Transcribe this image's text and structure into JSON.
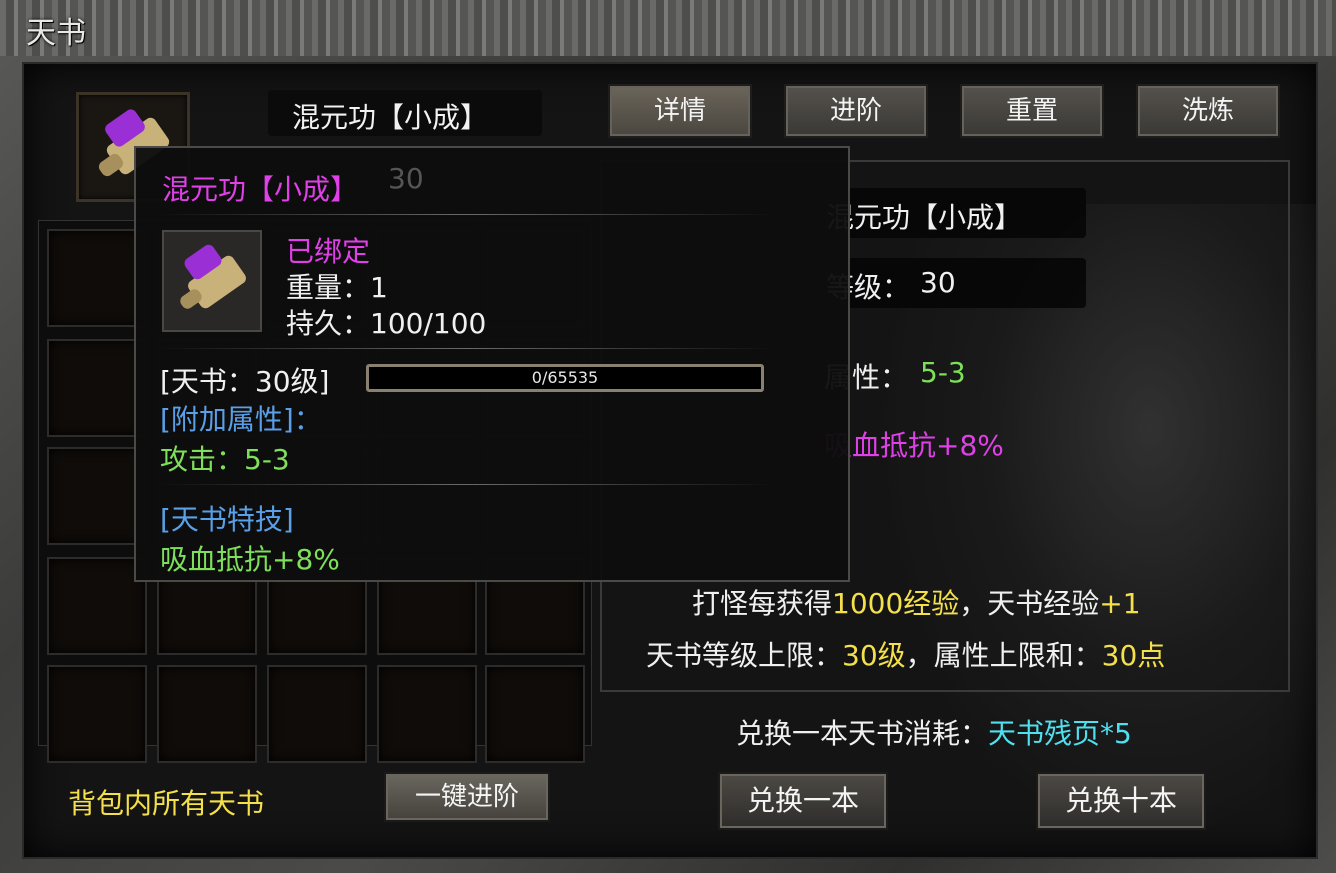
{
  "window": {
    "title": "天书"
  },
  "item": {
    "name": "混元功【小成】"
  },
  "tabs": [
    {
      "label": "详情",
      "active": true
    },
    {
      "label": "进阶",
      "active": false
    },
    {
      "label": "重置",
      "active": false
    },
    {
      "label": "洗炼",
      "active": false
    }
  ],
  "detail": {
    "name": "混元功【小成】",
    "level_label": "等级：",
    "level_value": "30",
    "attr_label": "属性：",
    "attr_value": "5-3",
    "special": "吸血抵抗+8%"
  },
  "info": {
    "exp_prefix": "打怪每获得",
    "exp_amount": "1000经验",
    "exp_middle": "，天书经验",
    "exp_gain": "+1",
    "limit_prefix": "天书等级上限：",
    "limit_level": "30级",
    "limit_middle": "，属性上限和：",
    "limit_points": "30点",
    "exchange_prefix": "兑换一本天书消耗：",
    "exchange_cost": "天书残页*5"
  },
  "buttons": {
    "exchange_one": "兑换一本",
    "exchange_ten": "兑换十本",
    "one_click_advance": "一键进阶"
  },
  "bag_label": "背包内所有天书",
  "tooltip": {
    "title": "混元功【小成】",
    "behind_value": "30",
    "bound": "已绑定",
    "weight": "重量：1",
    "durability": "持久：100/100",
    "book_level": "[天书：30级]",
    "exp_bar_text": "0/65535",
    "exp_progress": 0,
    "extra_attr_header": "[附加属性]：",
    "attack": "攻击：5-3",
    "skill_header": "[天书特技]",
    "skill": "吸血抵抗+8%"
  },
  "colors": {
    "purple": "#e040e8",
    "green": "#7ee05a",
    "yellow": "#f3e04a",
    "cyan": "#4fe0f0",
    "blue": "#5aa0e8"
  }
}
